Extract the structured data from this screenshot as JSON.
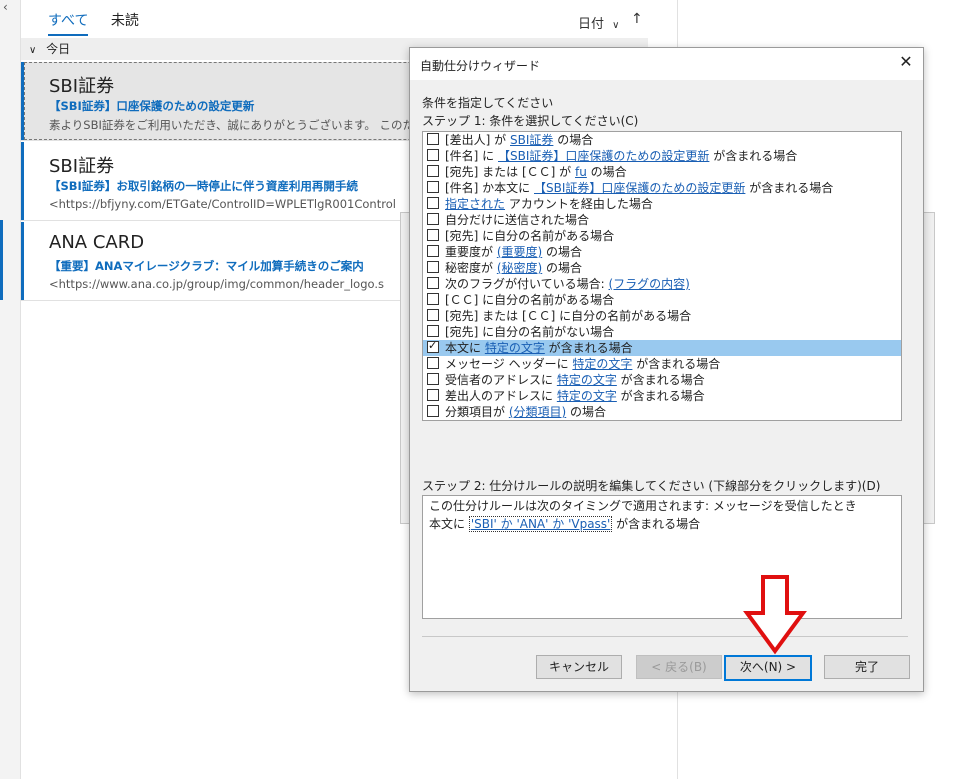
{
  "mail": {
    "tabs": [
      "すべて",
      "未読"
    ],
    "sort_label": "日付",
    "sort_arrow": "↑",
    "group_label": "今日",
    "items": [
      {
        "sender": "SBI証券",
        "subject": "【SBI証券】口座保護のための設定更新",
        "preview": "素よりSBI証券をご利用いただき、誠にありがとうございます。 このたび、お客様"
      },
      {
        "sender": "SBI証券",
        "subject": "【SBI証券】お取引銘柄の一時停止に伴う資産利用再開手続",
        "preview": "<https://bfjyny.com/ETGate/ControlID=WPLETlgR001Control"
      },
      {
        "sender": "ANA CARD",
        "subject": "【重要】ANAマイレージクラブ：マイル加算手続きのご案内",
        "preview": "<https://www.ana.co.jp/group/img/common/header_logo.s"
      }
    ]
  },
  "dialog": {
    "title": "自動仕分けウィザード",
    "instruction": "条件を指定してください",
    "step1_label": "ステップ 1: 条件を選択してください(C)",
    "conditions": [
      {
        "pre": "[差出人] が ",
        "link": "SBI証券",
        "post": " の場合",
        "checked": false
      },
      {
        "pre": "[件名] に ",
        "link": "【SBI証券】口座保護のための設定更新",
        "post": " が含まれる場合",
        "checked": false
      },
      {
        "pre": "[宛先] または [ＣＣ] が ",
        "link": "fu",
        "post": " の場合",
        "checked": false
      },
      {
        "pre": "[件名] か本文に ",
        "link": "【SBI証券】口座保護のための設定更新",
        "post": " が含まれる場合",
        "checked": false
      },
      {
        "pre": "",
        "link": "指定された",
        "post": " アカウントを経由した場合",
        "checked": false
      },
      {
        "pre": "自分だけに送信された場合",
        "link": "",
        "post": "",
        "checked": false
      },
      {
        "pre": "[宛先] に自分の名前がある場合",
        "link": "",
        "post": "",
        "checked": false
      },
      {
        "pre": "重要度が ",
        "link": "(重要度)",
        "post": " の場合",
        "checked": false
      },
      {
        "pre": "秘密度が ",
        "link": "(秘密度)",
        "post": " の場合",
        "checked": false
      },
      {
        "pre": "次のフラグが付いている場合: ",
        "link": "(フラグの内容)",
        "post": "",
        "checked": false
      },
      {
        "pre": "[ＣＣ] に自分の名前がある場合",
        "link": "",
        "post": "",
        "checked": false
      },
      {
        "pre": "[宛先] または [ＣＣ] に自分の名前がある場合",
        "link": "",
        "post": "",
        "checked": false
      },
      {
        "pre": "[宛先] に自分の名前がない場合",
        "link": "",
        "post": "",
        "checked": false
      },
      {
        "pre": "本文に ",
        "link": "特定の文字",
        "post": " が含まれる場合",
        "checked": true
      },
      {
        "pre": "メッセージ ヘッダーに ",
        "link": "特定の文字",
        "post": " が含まれる場合",
        "checked": false
      },
      {
        "pre": "受信者のアドレスに ",
        "link": "特定の文字",
        "post": " が含まれる場合",
        "checked": false
      },
      {
        "pre": "差出人のアドレスに ",
        "link": "特定の文字",
        "post": " が含まれる場合",
        "checked": false
      },
      {
        "pre": "分類項目が ",
        "link": "(分類項目)",
        "post": " の場合",
        "checked": false
      }
    ],
    "step2_label": "ステップ 2: 仕分けルールの説明を編集してください (下線部分をクリックします)(D)",
    "description": {
      "line1": "この仕分けルールは次のタイミングで適用されます: メッセージを受信したとき",
      "line2_pre": "本文に ",
      "line2_link": "'SBI' か 'ANA' か 'Vpass'",
      "line2_post": " が含まれる場合"
    },
    "buttons": {
      "cancel": "キャンセル",
      "back": "< 戻る(B)",
      "next": "次へ(N) >",
      "finish": "完了"
    }
  },
  "colors": {
    "accent": "#0f6cbd",
    "highlight_arrow": "#e01010",
    "selection": "#99c9ef"
  }
}
